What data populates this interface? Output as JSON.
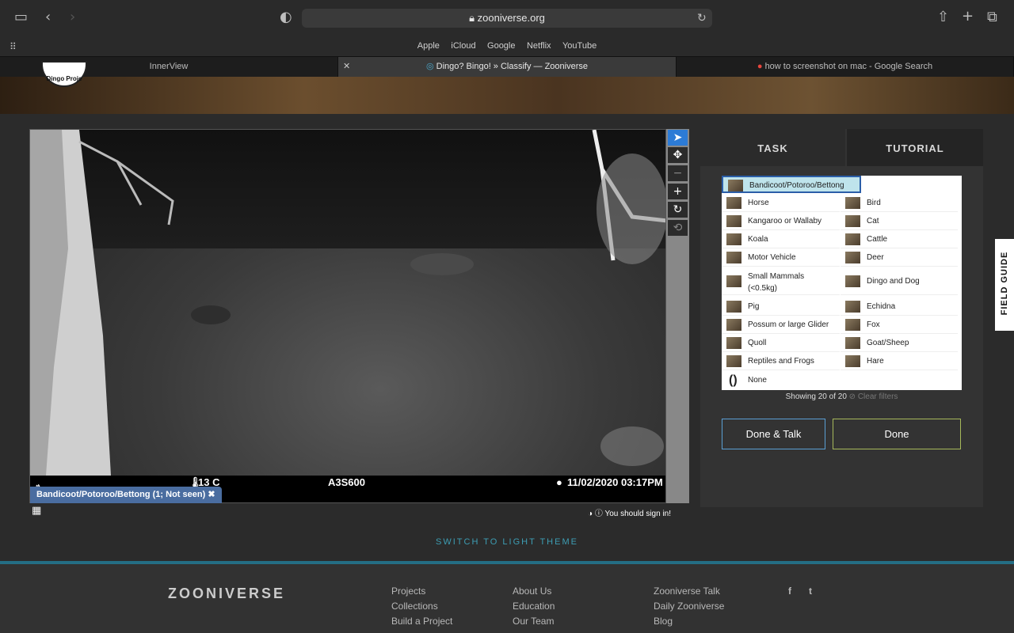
{
  "browser": {
    "url": "zooniverse.org",
    "favorites": [
      "Apple",
      "iCloud",
      "Google",
      "Netflix",
      "YouTube"
    ],
    "tabs": [
      {
        "label": "InnerView"
      },
      {
        "label": "Dingo? Bingo! » Classify — Zooniverse"
      },
      {
        "label": "how to screenshot on mac - Google Search"
      }
    ]
  },
  "banner": {
    "logo_text": "Dingo Proje"
  },
  "viewer": {
    "temperature": "13 C",
    "camera_id": "A3S600",
    "datetime": "11/02/2020  03:17PM",
    "mark_label": "Bandicoot/Potoroo/Bettong (1; Not seen)"
  },
  "tools": {
    "select": "pointer-icon",
    "move": "move-icon",
    "zoom_out": "minus-icon",
    "zoom_in": "plus-icon",
    "rotate": "rotate-icon",
    "reset": "reset-icon"
  },
  "panel": {
    "tab_task": "TASK",
    "tab_tutorial": "TUTORIAL",
    "choices_left": [
      "Bandicoot/Potoroo/Bettong",
      "Horse",
      "Kangaroo or Wallaby",
      "Koala",
      "Motor Vehicle",
      "Small Mammals (<0.5kg)",
      "Pig",
      "Possum or large Glider",
      "Quoll",
      "Reptiles and Frogs",
      "None"
    ],
    "choices_right": [
      "Bird",
      "Cat",
      "Cattle",
      "Deer",
      "Dingo and Dog",
      "Echidna",
      "Fox",
      "Goat/Sheep",
      "Hare"
    ],
    "showing": "Showing 20 of 20",
    "clear_filters": "Clear filters",
    "done_talk": "Done & Talk",
    "done": "Done"
  },
  "field_guide": "FIELD GUIDE",
  "signin": "You should sign in!",
  "switch_theme": "SWITCH TO LIGHT THEME",
  "footer": {
    "logo": "ZOONIVERSE",
    "col1": [
      "Projects",
      "Collections",
      "Build a Project"
    ],
    "col2": [
      "About Us",
      "Education",
      "Our Team"
    ],
    "col3": [
      "Zooniverse Talk",
      "Daily Zooniverse",
      "Blog"
    ],
    "social": [
      "f",
      "t"
    ]
  },
  "colors": {
    "accent": "#3d9db3",
    "selected_tool": "#2c7bd6",
    "mark_label": "#4a6da0",
    "selected_choice": "#bfe4ec"
  }
}
